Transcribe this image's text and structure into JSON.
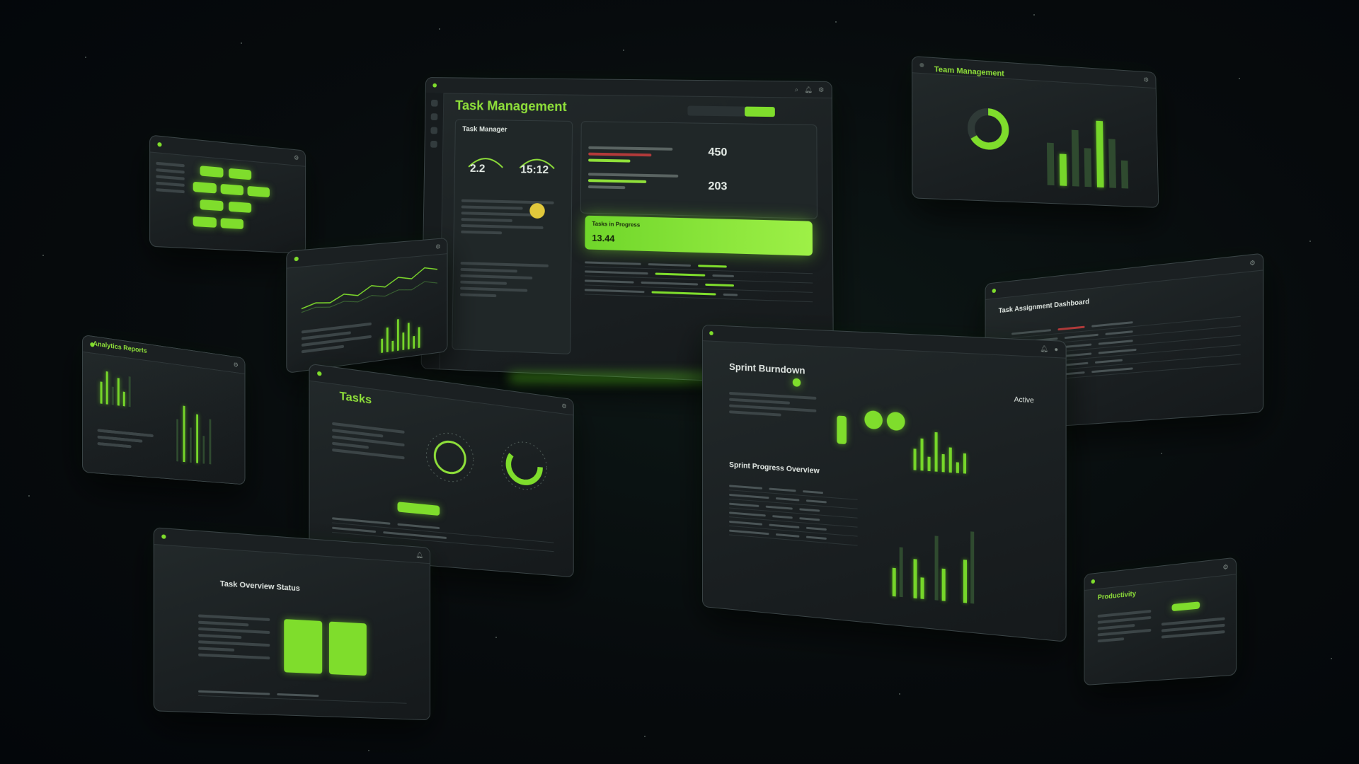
{
  "background": {
    "color": "#05080b",
    "accent": "#8fe03a"
  },
  "main_panel": {
    "title": "Task Management",
    "card_title": "Task Manager",
    "stat_a": "2.2",
    "stat_b": "15:12",
    "stat_c": "450",
    "stat_d": "203",
    "band_label": "Tasks in Progress",
    "band_value": "13.44"
  },
  "top_right_panel": {
    "title": "Team Management"
  },
  "left_panel_1": {
    "title": ""
  },
  "left_panel_2": {
    "title": ""
  },
  "left_panel_3": {
    "title": "Analytics Reports"
  },
  "middle_panel": {
    "title": "Tasks"
  },
  "bottom_left_panel": {
    "title": "Task Overview Status"
  },
  "right_panel": {
    "title": "Task Assignment Dashboard"
  },
  "big_panel": {
    "title": "Sprint Burndown",
    "section_title": "Sprint Progress Overview",
    "tag": "Active"
  },
  "bottom_right_panel": {
    "title": "Productivity"
  },
  "icons": [
    "gear-icon",
    "bell-icon",
    "user-icon",
    "search-icon"
  ]
}
